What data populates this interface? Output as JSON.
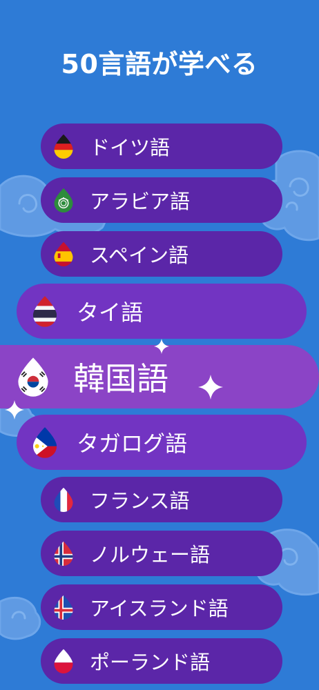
{
  "header": {
    "title": "50言語が学べる"
  },
  "languages": [
    {
      "label": "ドイツ語",
      "flag": "germany-flag-icon"
    },
    {
      "label": "アラビア語",
      "flag": "arabic-flag-icon"
    },
    {
      "label": "スペイン語",
      "flag": "spain-flag-icon"
    },
    {
      "label": "タイ語",
      "flag": "thailand-flag-icon"
    },
    {
      "label": "韓国語",
      "flag": "korea-flag-icon"
    },
    {
      "label": "タガログ語",
      "flag": "philippines-flag-icon"
    },
    {
      "label": "フランス語",
      "flag": "france-flag-icon"
    },
    {
      "label": "ノルウェー語",
      "flag": "norway-flag-icon"
    },
    {
      "label": "アイスランド語",
      "flag": "iceland-flag-icon"
    },
    {
      "label": "ポーランド語",
      "flag": "poland-flag-icon"
    }
  ],
  "colors": {
    "background": "#2e7bd6",
    "pill_small": "#5b26a8",
    "pill_medium": "#7234c2",
    "pill_large": "#8b44c6",
    "text": "#ffffff"
  }
}
